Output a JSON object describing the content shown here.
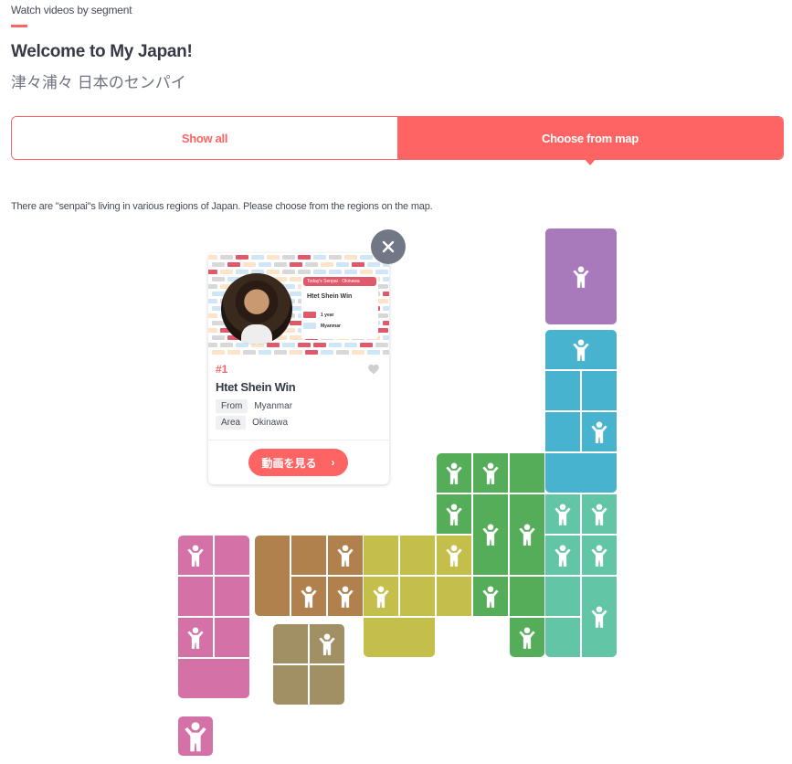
{
  "header": {
    "eyebrow": "Watch videos by segment",
    "title": "Welcome to My Japan!",
    "subtitle": "津々浦々 日本のセンパイ"
  },
  "tabs": [
    {
      "label": "Show all",
      "active": false
    },
    {
      "label": "Choose from map",
      "active": true
    }
  ],
  "intro_text": "There are \"senpai\"s living in various regions of Japan. Please choose from the regions on the map.",
  "colors": {
    "accent": "#ff6464",
    "hokkaido": "#a87abc",
    "tohoku": "#47b3cf",
    "kanto": "#62c6a6",
    "chubu": "#55ad5a",
    "kinki": "#c4bf4a",
    "chugoku": "#b0814d",
    "shikoku": "#a09063",
    "kyushu": "#d472a8"
  },
  "popup": {
    "rank": "#1",
    "name": "Htet Shein Win",
    "from_label": "From",
    "from_value": "Myanmar",
    "area_label": "Area",
    "area_value": "Okinawa",
    "watch_button": "動画を見る",
    "watch_chevron": "›",
    "close_icon": "×",
    "thumbnail": {
      "banner": "Today's Senpai",
      "banner_area": "Okinawa",
      "name": "Htet Shein Win",
      "row1": "1 year",
      "row2": "Myanmar"
    }
  },
  "map_regions": [
    {
      "region": "hokkaido",
      "cells": [
        {
          "has_senpai": true
        }
      ]
    },
    {
      "region": "tohoku",
      "cells": [
        {
          "has_senpai": true
        },
        {
          "has_senpai": false
        },
        {
          "has_senpai": false
        },
        {
          "has_senpai": false
        },
        {
          "has_senpai": true
        },
        {
          "has_senpai": false
        }
      ]
    },
    {
      "region": "kanto",
      "cells": [
        {
          "has_senpai": true
        },
        {
          "has_senpai": true
        },
        {
          "has_senpai": true
        },
        {
          "has_senpai": true
        },
        {
          "has_senpai": false
        },
        {
          "has_senpai": false
        },
        {
          "has_senpai": true
        }
      ]
    },
    {
      "region": "chubu",
      "cells": [
        {
          "has_senpai": true
        },
        {
          "has_senpai": true
        },
        {
          "has_senpai": false
        },
        {
          "has_senpai": true
        },
        {
          "has_senpai": true
        },
        {
          "has_senpai": true
        },
        {
          "has_senpai": true
        },
        {
          "has_senpai": false
        },
        {
          "has_senpai": true
        }
      ]
    },
    {
      "region": "kinki",
      "cells": [
        {
          "has_senpai": false
        },
        {
          "has_senpai": false
        },
        {
          "has_senpai": true
        },
        {
          "has_senpai": true
        },
        {
          "has_senpai": false
        },
        {
          "has_senpai": false
        },
        {
          "has_senpai": false
        },
        {
          "has_senpai": false
        }
      ]
    },
    {
      "region": "chugoku",
      "cells": [
        {
          "has_senpai": false
        },
        {
          "has_senpai": false
        },
        {
          "has_senpai": true
        },
        {
          "has_senpai": true
        },
        {
          "has_senpai": true
        }
      ]
    },
    {
      "region": "shikoku",
      "cells": [
        {
          "has_senpai": false
        },
        {
          "has_senpai": true
        },
        {
          "has_senpai": false
        },
        {
          "has_senpai": false
        }
      ]
    },
    {
      "region": "kyushu",
      "cells": [
        {
          "has_senpai": true
        },
        {
          "has_senpai": false
        },
        {
          "has_senpai": false
        },
        {
          "has_senpai": false
        },
        {
          "has_senpai": true
        },
        {
          "has_senpai": false
        },
        {
          "has_senpai": false
        }
      ]
    },
    {
      "region": "okinawa",
      "cells": [
        {
          "has_senpai": true
        }
      ]
    }
  ]
}
